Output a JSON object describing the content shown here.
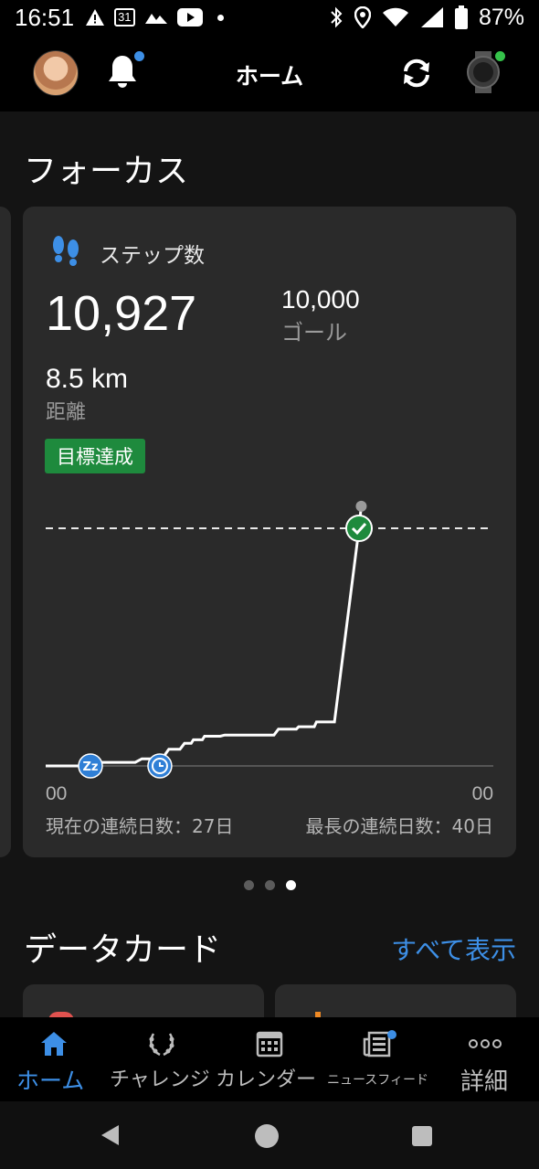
{
  "status_bar": {
    "time": "16:51",
    "calendar_day": "31",
    "battery_percent": "87%"
  },
  "header": {
    "title": "ホーム"
  },
  "focus": {
    "section_title": "フォーカス",
    "card": {
      "title": "ステップ数",
      "steps": "10,927",
      "goal_value": "10,000",
      "goal_label": "ゴール",
      "distance_value": "8.5 km",
      "distance_label": "距離",
      "badge": "目標達成",
      "axis_start": "00",
      "axis_end": "00",
      "current_streak": "現在の連続日数：27日",
      "longest_streak": "最長の連続日数：40日"
    },
    "pager": {
      "count": 3,
      "active": 2
    }
  },
  "data_cards": {
    "section_title": "データカード",
    "see_all": "すべて表示"
  },
  "bottom_nav": {
    "items": [
      {
        "label": "ホーム",
        "icon": "home-icon",
        "active": true
      },
      {
        "label": "チャレンジ",
        "icon": "laurel-icon",
        "active": false
      },
      {
        "label": "カレンダー",
        "icon": "calendar-icon",
        "active": false
      },
      {
        "label": "ニュースフィード",
        "icon": "newsfeed-icon",
        "active": false
      },
      {
        "label": "詳細",
        "icon": "more-icon",
        "active": false
      }
    ]
  },
  "chart_data": {
    "type": "line",
    "title": "",
    "xlabel": "",
    "ylabel": "",
    "x_tick_labels": [
      "00",
      "00"
    ],
    "goal": 10000,
    "ylim": [
      0,
      10000
    ],
    "series": [
      {
        "points": [
          [
            0,
            0
          ],
          [
            0.9,
            0
          ],
          [
            1.0,
            150
          ],
          [
            2.0,
            150
          ],
          [
            2.15,
            300
          ],
          [
            2.6,
            300
          ],
          [
            2.75,
            700
          ],
          [
            3.0,
            700
          ],
          [
            3.1,
            950
          ],
          [
            3.25,
            950
          ],
          [
            3.3,
            1100
          ],
          [
            3.5,
            1100
          ],
          [
            3.55,
            1250
          ],
          [
            3.9,
            1250
          ],
          [
            4.0,
            1300
          ],
          [
            5.1,
            1300
          ],
          [
            5.2,
            1550
          ],
          [
            5.6,
            1550
          ],
          [
            5.65,
            1650
          ],
          [
            6.0,
            1650
          ],
          [
            6.05,
            1850
          ],
          [
            6.45,
            1850
          ],
          [
            7.0,
            10000
          ],
          [
            7.05,
            10927
          ]
        ]
      }
    ],
    "markers": [
      {
        "name": "sleep",
        "x": 1.0,
        "icon": "sleep-icon"
      },
      {
        "name": "activity",
        "x": 2.55,
        "icon": "stopwatch-icon"
      },
      {
        "name": "goal-reached",
        "x": 7.0,
        "icon": "check-icon"
      }
    ],
    "x_range": [
      0,
      10
    ],
    "colors": {
      "line": "#ffffff",
      "goal_marker": "#1e8a3d",
      "event_marker": "#2f7fd6"
    }
  }
}
